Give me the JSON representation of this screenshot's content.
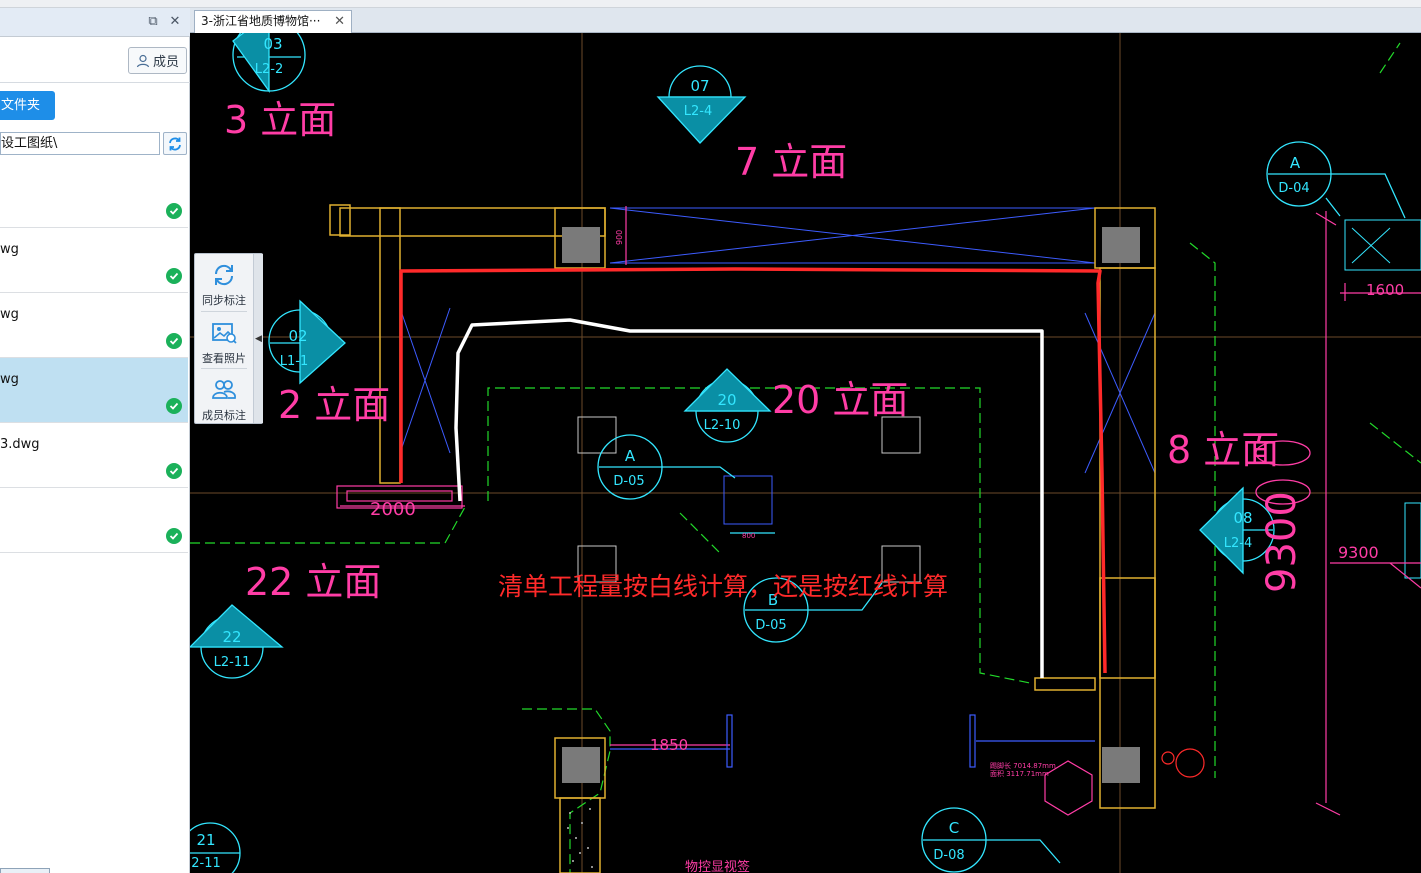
{
  "left_panel": {
    "members_button": "成员",
    "folder_button": "文件夹",
    "path_value": "设工图纸\\",
    "files": [
      {
        "name": "",
        "selected": false
      },
      {
        "name": "wg",
        "selected": false
      },
      {
        "name": "wg",
        "selected": false
      },
      {
        "name": "wg",
        "selected": true
      },
      {
        "name": "3.dwg",
        "selected": false
      },
      {
        "name": "",
        "selected": false
      }
    ]
  },
  "tab_bar": {
    "doc_tab": "3-浙江省地质博物馆···",
    "close_glyph": "✕"
  },
  "toolbar": {
    "sync_label": "同步标注",
    "photo_label": "查看照片",
    "member_label": "成员标注"
  },
  "drawing": {
    "annotation": "清单工程量按白线计算，还是按红线计算",
    "elevations": [
      {
        "label": "3 立面",
        "num": "03",
        "ref": "L2-2"
      },
      {
        "label": "7 立面",
        "num": "07",
        "ref": "L2-4"
      },
      {
        "label": "2 立面",
        "num": "02",
        "ref": "L1-1"
      },
      {
        "label": "20 立面",
        "num": "20",
        "ref": "L2-10"
      },
      {
        "label": "8 立面",
        "num": "08",
        "ref": "L2-4"
      },
      {
        "label": "22 立面",
        "num": "22",
        "ref": "L2-11"
      },
      {
        "label": "",
        "num": "21",
        "ref": "2-11"
      }
    ],
    "details": [
      {
        "letter": "A",
        "ref": "D-04"
      },
      {
        "letter": "A",
        "ref": "D-05"
      },
      {
        "letter": "B",
        "ref": "D-05"
      },
      {
        "letter": "C",
        "ref": "D-08"
      }
    ],
    "dims": {
      "d900": "900",
      "d1600": "1600",
      "d2000": "2000",
      "d9300a": "9300",
      "d9300b": "9300",
      "d1850": "1850",
      "d800": "800"
    },
    "notes": {
      "area_a": "踢脚长 7014.87mm",
      "area_b": "面积 3117.71mm",
      "bottom_label": "物控显视签"
    }
  },
  "colors": {
    "canvas": "#000000",
    "magenta": "#ff3da6",
    "cyan": "#33e6ff",
    "yellow": "#e0b030",
    "green": "#22d92a",
    "red_line": "#ff2a2a",
    "white_line": "#ffffff",
    "annotation": "#ff2a2a",
    "accent": "#1e8ee8"
  }
}
